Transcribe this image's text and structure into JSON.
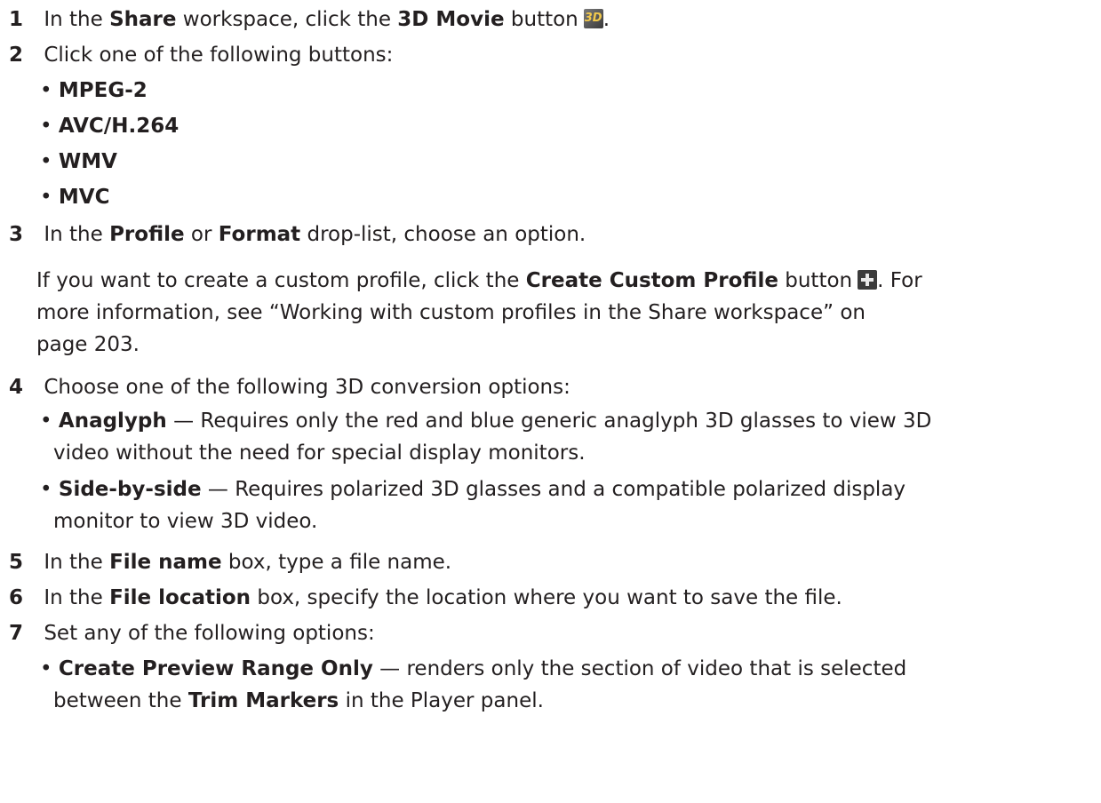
{
  "steps": [
    {
      "num": "1",
      "parts": [
        "In the ",
        "Share",
        " workspace, click the ",
        "3D Movie",
        " button",
        "."
      ],
      "icon": "3d-movie-icon",
      "icon_text": "3D"
    },
    {
      "num": "2",
      "text": "Click one of the following buttons:",
      "bullets": [
        "MPEG-2",
        "AVC/H.264",
        "WMV",
        "MVC"
      ]
    },
    {
      "num": "3",
      "parts": [
        "In the ",
        "Profile",
        " or ",
        "Format",
        " drop-list, choose an option."
      ],
      "note": {
        "p1": "If you want to create a custom profile, click the ",
        "b1": "Create Custom Profile",
        "p2": " button",
        "p3": ". For",
        "line2": "more information, see “Working with custom profiles in the Share workspace” on",
        "line3": "page 203.",
        "icon": "plus-icon"
      }
    },
    {
      "num": "4",
      "text": "Choose one of the following 3D conversion options:",
      "options": [
        {
          "name": "Anaglyph",
          "line1": " — Requires only the red and blue generic anaglyph 3D glasses to view 3D",
          "line2": "video without the need for special display monitors."
        },
        {
          "name": "Side-by-side",
          "line1": " — Requires polarized 3D glasses and a compatible polarized display",
          "line2": "monitor to view 3D video."
        }
      ]
    },
    {
      "num": "5",
      "parts": [
        "In the ",
        "File name",
        " box, type a file name."
      ]
    },
    {
      "num": "6",
      "parts": [
        "In the ",
        "File location",
        " box, specify the location where you want to save the file."
      ]
    },
    {
      "num": "7",
      "text": "Set any of the following options:",
      "options": [
        {
          "name": "Create Preview Range Only",
          "line1": " — renders only the section of video that is selected",
          "line2a": "between the ",
          "line2b": "Trim Markers",
          "line2c": " in the Player panel."
        }
      ]
    }
  ],
  "bullet_char": "•"
}
